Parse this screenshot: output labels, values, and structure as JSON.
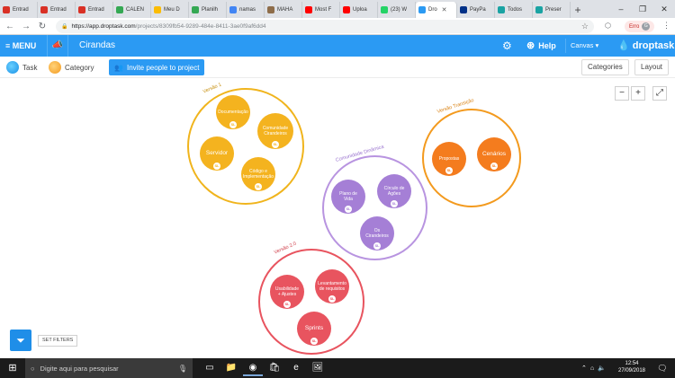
{
  "browser": {
    "tabs": [
      {
        "label": "Entrad",
        "icon_color": "#d93025",
        "icon": "gmail-icon"
      },
      {
        "label": "Entrad",
        "icon_color": "#d93025",
        "icon": "gmail-icon"
      },
      {
        "label": "Entrad",
        "icon_color": "#d93025",
        "icon": "gmail-icon"
      },
      {
        "label": "CALEN",
        "icon_color": "#34a853",
        "icon": "sheets-icon"
      },
      {
        "label": "Meu D",
        "icon_color": "#fbbc04",
        "icon": "drive-icon"
      },
      {
        "label": "Planilh",
        "icon_color": "#34a853",
        "icon": "sheets-icon"
      },
      {
        "label": "namas",
        "icon_color": "#4285f4",
        "icon": "google-icon"
      },
      {
        "label": "MAHA",
        "icon_color": "#8e6d4a",
        "icon": "page-icon"
      },
      {
        "label": "Most F",
        "icon_color": "#ff0000",
        "icon": "youtube-icon"
      },
      {
        "label": "Uploa",
        "icon_color": "#ff0000",
        "icon": "youtube-icon"
      },
      {
        "label": "(23) W",
        "icon_color": "#25d366",
        "icon": "whatsapp-icon"
      },
      {
        "label": "Dro",
        "icon_color": "#2b9af3",
        "icon": "droptask-icon",
        "active": true
      },
      {
        "label": "PayPa",
        "icon_color": "#003087",
        "icon": "paypal-icon"
      },
      {
        "label": "Todos",
        "icon_color": "#1aa3a3",
        "icon": "c-icon"
      },
      {
        "label": "Preser",
        "icon_color": "#1aa3a3",
        "icon": "c-icon"
      }
    ],
    "new_tab": "+",
    "window_controls": {
      "minimize": "–",
      "maximize": "❐",
      "close": "✕"
    },
    "url_host": "https://app.droptask.com",
    "url_path": "/projects/8309fb54-9289-484e-8411-3ae0f9af6dd4",
    "profile_label": "Erro",
    "profile_initial": "G"
  },
  "header": {
    "menu_label": "≡ MENU",
    "project_title": "Cirandas",
    "help_label": "Help",
    "view_label": "Canvas",
    "brand": "droptask"
  },
  "toolbar": {
    "task_label": "Task",
    "category_label": "Category",
    "invite_label": "Invite people to project",
    "categories_label": "Categories",
    "layout_label": "Layout"
  },
  "zoom": {
    "minus": "−",
    "plus": "+",
    "fit": "⤢"
  },
  "categories": [
    {
      "name": "Versão 1",
      "color": "#f0b41c"
    },
    {
      "name": "Versão Transição",
      "color": "#f39a1e"
    },
    {
      "name": "Comunidade Dinâmica",
      "color": "#a57fd6"
    },
    {
      "name": "Versão 2.0",
      "color": "#e8545f"
    }
  ],
  "tasks": {
    "documentacao": "Documentação",
    "comunidade_cirandeiros": "Comunidade Cirandeiros",
    "servidor": "Servidor",
    "codigo_implementacao": "Código e Implementação",
    "propostas": "Propostas",
    "cenarios": "Cenários",
    "plano_de_vida": "Plano de Vida",
    "circulo_de_agoes": "Círculo de Agões",
    "os_cirandeiros": "Os Cirandeiros",
    "usabilidade_ajustes": "Usabilidade + Ajustes",
    "levantamento_requisitos": "Levantamento de requisitos",
    "sprints": "Sprints"
  },
  "filters": {
    "set_filters_label": "SET FILTERS"
  },
  "taskbar": {
    "search_placeholder": "Digite aqui para pesquisar",
    "time": "12:54",
    "date": "27/09/2018"
  }
}
